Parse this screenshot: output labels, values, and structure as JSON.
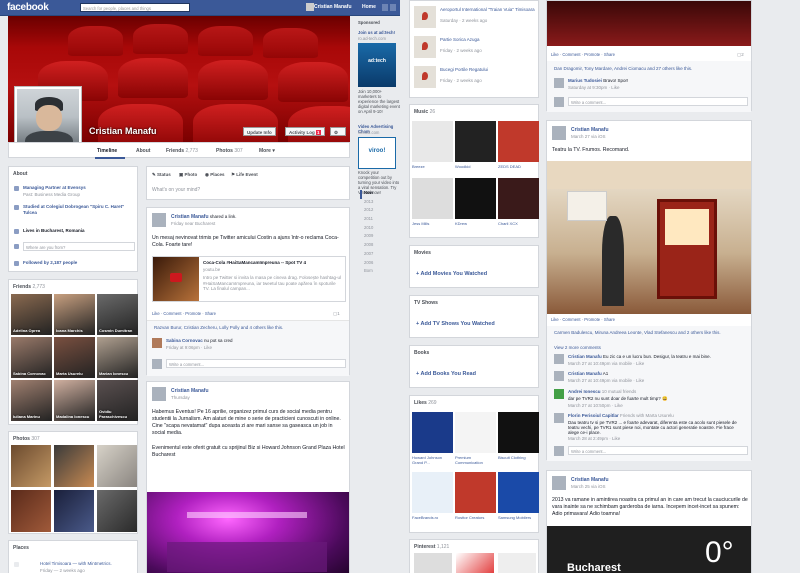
{
  "topbar": {
    "logo": "facebook",
    "search_placeholder": "Search for people, places and things",
    "user": "Cristian Manafu",
    "home": "Home"
  },
  "profile": {
    "name": "Cristian Manafu",
    "update_info": "Update Info",
    "activity_log": "Activity Log",
    "activity_count": "1"
  },
  "nav": {
    "timeline": "Timeline",
    "about": "About",
    "friends": "Friends",
    "friends_count": "2,773",
    "photos": "Photos",
    "photos_count": "307",
    "more": "More"
  },
  "about": {
    "title": "About",
    "work": "Managing Partner at Evensys",
    "work_sub": "Past: Business Media Group",
    "study": "Studied at Colegiul Dobrogean \"Spiru C. Haret\" Tulcea",
    "lives": "Lives in Bucharest, Romania",
    "where_placeholder": "Where are you from?",
    "followed": "Followed by 2,187 people"
  },
  "friends": {
    "title": "Friends",
    "count": "2,773",
    "items": [
      {
        "name": "Adelina Oprea"
      },
      {
        "name": "Ioana Marchis"
      },
      {
        "name": "Cosmin Dumitran"
      },
      {
        "name": "Sabina Cornovac"
      },
      {
        "name": "Marta Usurelu"
      },
      {
        "name": "Marian Ionescu"
      },
      {
        "name": "Iuliana Marinu"
      },
      {
        "name": "Madalina Ionescu"
      },
      {
        "name": "Ovidiu Paraschivescu"
      }
    ]
  },
  "photos": {
    "title": "Photos",
    "count": "307"
  },
  "places": {
    "title": "Places",
    "item": "Hotel Timisoara — with Mintmetrics.",
    "item_sub": "Friday — 2 weeks ago"
  },
  "composer": {
    "status": "Status",
    "photo": "Photo",
    "places": "Places",
    "life_event": "Life Event",
    "placeholder": "What's on your mind?"
  },
  "post1": {
    "author": "Cristian Manafu",
    "meta_suffix": "shared a link.",
    "time": "Friday near Bucharest",
    "text": "Un mesaj nevinovat trimis pe Twitter amicului Costin a ajuns într-o reclama Coca-Cola. Foarte tare!",
    "link_title": "Coca-Cola #HaiSaMancamImpreuna -- Spot TV 4",
    "link_src": "youtu.be",
    "link_desc": "Intro pe Twitter si invita la masa pe cineva drag. Folosește hashtag-ul #HaiSaMancamImpreuna, iar tweetul tau poate apărea în spoturile TV. La finalul campan...",
    "actions": "Like · Comment · Promote · Share",
    "comment_count": "1",
    "likes": "Razvan Burur, Cristian Zecheru, Lolly Polly and 4 others like this.",
    "commenter": "Sabina Cornovac",
    "comment": "nu pot sa cred",
    "comment_time": "Friday at 9:06pm · Like",
    "write_comment": "Write a comment..."
  },
  "post2": {
    "author": "Cristian Manafu",
    "time": "Thursday",
    "text1": "Habemus Eventus! Pe 16 aprilie, organizez primul curs de social media pentru studentii la Jurnalism. Am alaturi de mine o serie de practicieni cunoscuti in online. Cine \"scapa nevatamat\" dupa aceasta zi are mari sanse sa gaseasca un job in social media.",
    "text2": "Evenimentul este oferit gratuit cu sprijinul Biz si Howard Johnson Grand Plaza Hotel Bucharest"
  },
  "sponsored": {
    "title": "Sponsored",
    "ad1_title": "Join us at ad:tech!",
    "ad1_url": "ro.ad-tech.com",
    "ad1_text": "Join 10,000+ marketers to experience the largest digital marketing event on April 9-10!",
    "ad2_title": "Video Advertising Cham",
    "ad2_url": "viroool.com",
    "ad2_text": "Knock your competition out by turning your video into a viral sensation. Try Viroool now!",
    "ad2_logo": "viroo!"
  },
  "years": [
    "Now",
    "2013",
    "2012",
    "2011",
    "2010",
    "2009",
    "2008",
    "2007",
    "2006",
    "Born"
  ],
  "places_list": [
    {
      "name": "Aeroportul International \"Traian Vuia\" Timisoara",
      "sub": "Saturday · 2 weeks ago"
    },
    {
      "name": "Partie Sorica Azuga",
      "sub": "Friday · 2 weeks ago"
    },
    {
      "name": "Bucegi Portile Regatului",
      "sub": "Friday · 2 weeks ago"
    }
  ],
  "music": {
    "title": "Music",
    "count": "26",
    "items": [
      "Breeze",
      "Woodkid",
      "ZEDS DEAD",
      "Jess Mills",
      "KDrew",
      "Charli XCX"
    ]
  },
  "movies": {
    "title": "Movies",
    "add": "Add Movies You Watched"
  },
  "tv": {
    "title": "TV Shows",
    "add": "Add TV Shows You Watched"
  },
  "books": {
    "title": "Books",
    "add": "Add Books You Read"
  },
  "likes": {
    "title": "Likes",
    "count": "269",
    "items": [
      "Howard Johnson Grand P...",
      "Premium Communication",
      "Biscuit Clothing",
      "FaceBrands.ro",
      "Rosttor Creators",
      "Samsung Mobilers"
    ]
  },
  "pinterest": {
    "title": "Pinterest",
    "count": "1,121"
  },
  "right_top": {
    "actions": "Like · Comment · Promote · Share",
    "comment_count": "2",
    "likes": "Dan Dragomir, Tony Mardare, Andrei Ciomacu and 27 others like this.",
    "commenter": "Marius Tudosiei",
    "comment": "Bravo! Spor!",
    "comment_time": "Saturday at 9:30pm · Like",
    "write_comment": "Write a comment..."
  },
  "right_post": {
    "author": "Cristian Manafu",
    "time": "March 27 via iOS",
    "text": "Teatru la TV. Frumos. Recomand.",
    "actions": "Like · Comment · Promote · Share",
    "likes": "Carmen Badulescu, Miruna Andreea Leonte, Vlad Stefanescu and 2 others like this.",
    "view_more": "View 2 more comments",
    "c1_name": "Cristian Manafu",
    "c1": "Eu zic ca e un lucru bun. Desigur, la teatru e mai bine.",
    "c1_time": "March 27 at 10:49pm via mobile · Like",
    "c2_name": "Cristian Manafu",
    "c2": "A1",
    "c2_time": "March 27 at 10:49pm via mobile · Like",
    "c3_name": "Andrei Ionescu",
    "c3_meta": "10 mutual friends",
    "c3": "dar pe TVR2 nu sunt doar de fuarte mult timp? 😀",
    "c3_time": "March 27 at 10:50pm · Like",
    "c4_name": "Florin Perisoiul Capitlar",
    "c4_meta": "Friends with Marta Usurelu",
    "c4": "Dau teatru tv si pe TVR2 ... e foarte adevarat, diferenta este ca acolo sunt piesele de teatru vechi, pe TVR1 sunt piese noi, montate cu actori generatie noastre. Fie frace alege ce-i place.",
    "c4_time": "March 28 at 2:49pm · Like",
    "write_comment": "Write a comment..."
  },
  "right_post2": {
    "author": "Cristian Manafu",
    "time": "March 25 via iOS",
    "text": "2013 va ramane in amintirea noastra ca primul an in care am trecut la cauciucurile de vara inainte sa ne schimbam garderoba de iarna. Incepem incet-incet sa spunem: Adio primavara! Adio toamna!",
    "weather_city": "Bucharest",
    "weather_temp": "0°"
  }
}
